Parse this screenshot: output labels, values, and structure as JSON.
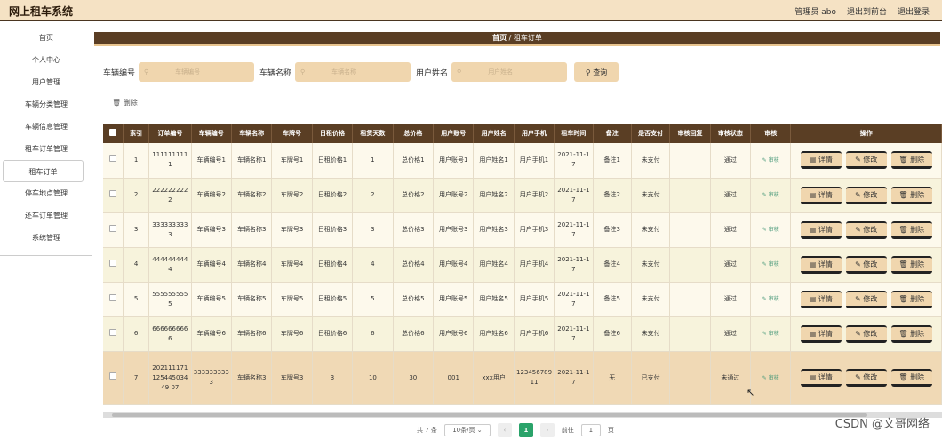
{
  "header": {
    "title": "网上租车系统",
    "user": "管理员 abo",
    "frontend": "退出到前台",
    "logout": "退出登录"
  },
  "sidebar": {
    "items": [
      "首页",
      "个人中心",
      "用户管理",
      "车辆分类管理",
      "车辆信息管理",
      "租车订单管理",
      "租车订单",
      "停车地点管理",
      "还车订单管理",
      "系统管理"
    ]
  },
  "breadcrumb": {
    "home": "首页",
    "sep": "/",
    "current": "租车订单"
  },
  "search": {
    "label1": "车辆编号",
    "ph1": "车辆编号",
    "label2": "车辆名称",
    "ph2": "车辆名称",
    "label3": "用户姓名",
    "ph3": "用户姓名",
    "button": "查询"
  },
  "actions": {
    "delete": "删除"
  },
  "table": {
    "headers": [
      "索引",
      "订单编号",
      "车辆编号",
      "车辆名称",
      "车牌号",
      "日租价格",
      "租赁天数",
      "总价格",
      "用户账号",
      "用户姓名",
      "用户手机",
      "租车时间",
      "备注",
      "是否支付",
      "审核回复",
      "审核状态",
      "审核",
      "操作"
    ],
    "audit_label": "审核",
    "op_detail": "详情",
    "op_edit": "修改",
    "op_delete": "删除",
    "rows": [
      [
        "1",
        "1111111111",
        "车辆编号1",
        "车辆名称1",
        "车牌号1",
        "日租价格1",
        "1",
        "总价格1",
        "用户账号1",
        "用户姓名1",
        "用户手机1",
        "2021-11-17",
        "备注1",
        "未支付",
        "",
        "通过"
      ],
      [
        "2",
        "2222222222",
        "车辆编号2",
        "车辆名称2",
        "车牌号2",
        "日租价格2",
        "2",
        "总价格2",
        "用户账号2",
        "用户姓名2",
        "用户手机2",
        "2021-11-17",
        "备注2",
        "未支付",
        "",
        "通过"
      ],
      [
        "3",
        "3333333333",
        "车辆编号3",
        "车辆名称3",
        "车牌号3",
        "日租价格3",
        "3",
        "总价格3",
        "用户账号3",
        "用户姓名3",
        "用户手机3",
        "2021-11-17",
        "备注3",
        "未支付",
        "",
        "通过"
      ],
      [
        "4",
        "4444444444",
        "车辆编号4",
        "车辆名称4",
        "车牌号4",
        "日租价格4",
        "4",
        "总价格4",
        "用户账号4",
        "用户姓名4",
        "用户手机4",
        "2021-11-17",
        "备注4",
        "未支付",
        "",
        "通过"
      ],
      [
        "5",
        "5555555555",
        "车辆编号5",
        "车辆名称5",
        "车牌号5",
        "日租价格5",
        "5",
        "总价格5",
        "用户账号5",
        "用户姓名5",
        "用户手机5",
        "2021-11-17",
        "备注5",
        "未支付",
        "",
        "通过"
      ],
      [
        "6",
        "6666666666",
        "车辆编号6",
        "车辆名称6",
        "车牌号6",
        "日租价格6",
        "6",
        "总价格6",
        "用户账号6",
        "用户姓名6",
        "用户手机6",
        "2021-11-17",
        "备注6",
        "未支付",
        "",
        "通过"
      ],
      [
        "7",
        "20211117112544503449 07",
        "3333333333",
        "车辆名称3",
        "车牌号3",
        "3",
        "10",
        "30",
        "001",
        "xxx用户",
        "12345678911",
        "2021-11-17",
        "无",
        "已支付",
        "",
        "未通过"
      ]
    ]
  },
  "pager": {
    "total": "共 7 条",
    "per_page": "10条/页",
    "current": "1",
    "goto_label": "前往",
    "goto_value": "1",
    "page_unit": "页"
  },
  "watermark": "CSDN @文哥网络"
}
